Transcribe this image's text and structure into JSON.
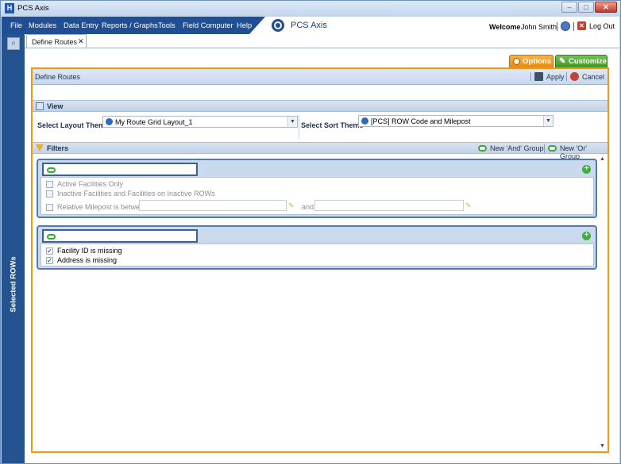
{
  "window": {
    "title": "PCS Axis",
    "controls": {
      "minimize": "–",
      "maximize": "□",
      "close": "✕"
    }
  },
  "menu": {
    "items": [
      "File",
      "Modules",
      "Data Entry",
      "Reports / Graphs",
      "Tools",
      "Field Computer",
      "Help"
    ],
    "brand": "PCS Axis",
    "welcome_label": "Welcome",
    "user_name": "John Smith",
    "logout_label": "Log Out"
  },
  "sidebar": {
    "label": "Selected ROWs",
    "search_icon": "search-icon"
  },
  "tabs": [
    {
      "label": "Define Routes",
      "close": "✕"
    }
  ],
  "toolbar": {
    "options_label": "Options",
    "customize_label": "Customize"
  },
  "panel": {
    "title": "Define Routes",
    "apply_label": "Apply",
    "cancel_label": "Cancel"
  },
  "view": {
    "heading": "View",
    "layout_label": "Select Layout Theme",
    "layout_value": "My Route Grid Layout_1",
    "sort_label": "Select Sort Theme",
    "sort_value": "[PCS] ROW Code and Milepost"
  },
  "filters": {
    "heading": "Filters",
    "new_and_label": "New 'And' Group",
    "new_or_label": "New 'Or' Group",
    "group1": {
      "input_value": "",
      "active_only": "Active Facilities Only",
      "inactive": "Inactive Facilities and Facilities on Inactive ROWs",
      "milepost": "Relative Milepost is between",
      "and_label": "and"
    },
    "group2": {
      "input_value": "",
      "facility_missing": "Facility ID is missing",
      "address_missing": "Address is missing"
    }
  },
  "colors": {
    "nav_blue": "#1f4e92",
    "accent_orange": "#e79a1c",
    "accent_green": "#3f9624"
  }
}
